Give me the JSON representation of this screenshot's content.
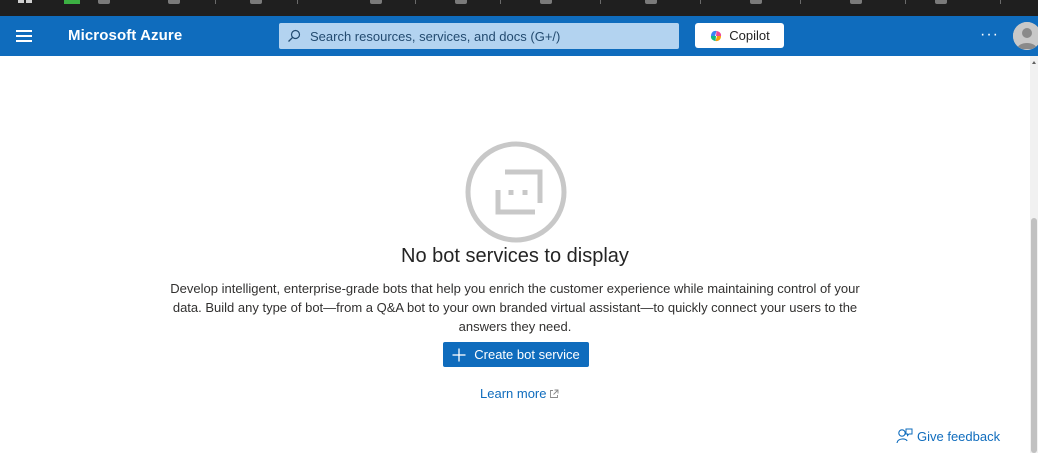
{
  "topbar": {
    "brand": "Microsoft Azure",
    "search_placeholder": "Search resources, services, and docs (G+/)",
    "copilot_label": "Copilot",
    "more_label": "···"
  },
  "empty_state": {
    "title": "No bot services to display",
    "description": "Develop intelligent, enterprise-grade bots that help you enrich the customer experience while maintaining control of your data. Build any type of bot—from a Q&A bot to your own branded virtual assistant—to quickly connect your users to the answers they need.",
    "create_button_label": "Create bot service",
    "learn_more_label": "Learn more"
  },
  "footer": {
    "feedback_label": "Give feedback"
  },
  "icons": {
    "menu": "hamburger-menu-icon",
    "search": "search-icon",
    "copilot": "copilot-icon",
    "more": "more-icon",
    "avatar": "avatar-icon",
    "empty": "bot-face-icon",
    "add": "plus-icon",
    "external": "external-link-icon",
    "feedback": "feedback-icon"
  },
  "colors": {
    "azure_blue": "#0f6cbd",
    "search_bg": "#b3d3f0",
    "icon_gray": "#c8c8c8"
  }
}
